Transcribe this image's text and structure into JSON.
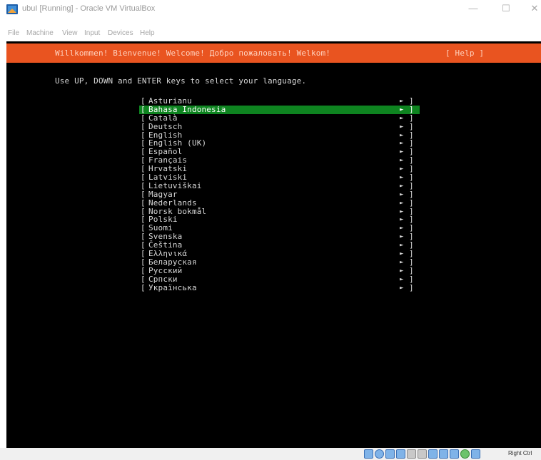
{
  "window": {
    "title": "ubuI [Running] - Oracle VM VirtualBox",
    "controls": {
      "minimize": "—",
      "maximize": "☐",
      "close": "✕"
    }
  },
  "menubar": {
    "items": [
      "File",
      "Machine",
      "View",
      "Input",
      "Devices",
      "Help"
    ]
  },
  "installer": {
    "banner": "Willkommen! Bienvenue! Welcome! Добро пожаловать! Welkom!",
    "help": "[ Help ]",
    "instruction": "Use UP, DOWN and ENTER keys to select your language.",
    "left_bracket": "[",
    "right_bracket": "]",
    "arrow": "►",
    "selected_index": 1,
    "languages": [
      "Asturianu",
      "Bahasa Indonesia",
      "Català",
      "Deutsch",
      "English",
      "English (UK)",
      "Español",
      "Français",
      "Hrvatski",
      "Latviski",
      "Lietuviškai",
      "Magyar",
      "Nederlands",
      "Norsk bokmål",
      "Polski",
      "Suomi",
      "Svenska",
      "Čeština",
      "Ελληνικά",
      "Беларуская",
      "Русский",
      "Српски",
      "Українська"
    ]
  },
  "statusbar": {
    "host_key": "Right Ctrl"
  },
  "colors": {
    "banner": "#e95420",
    "selection": "#0e8420",
    "terminal_bg": "#000000"
  }
}
